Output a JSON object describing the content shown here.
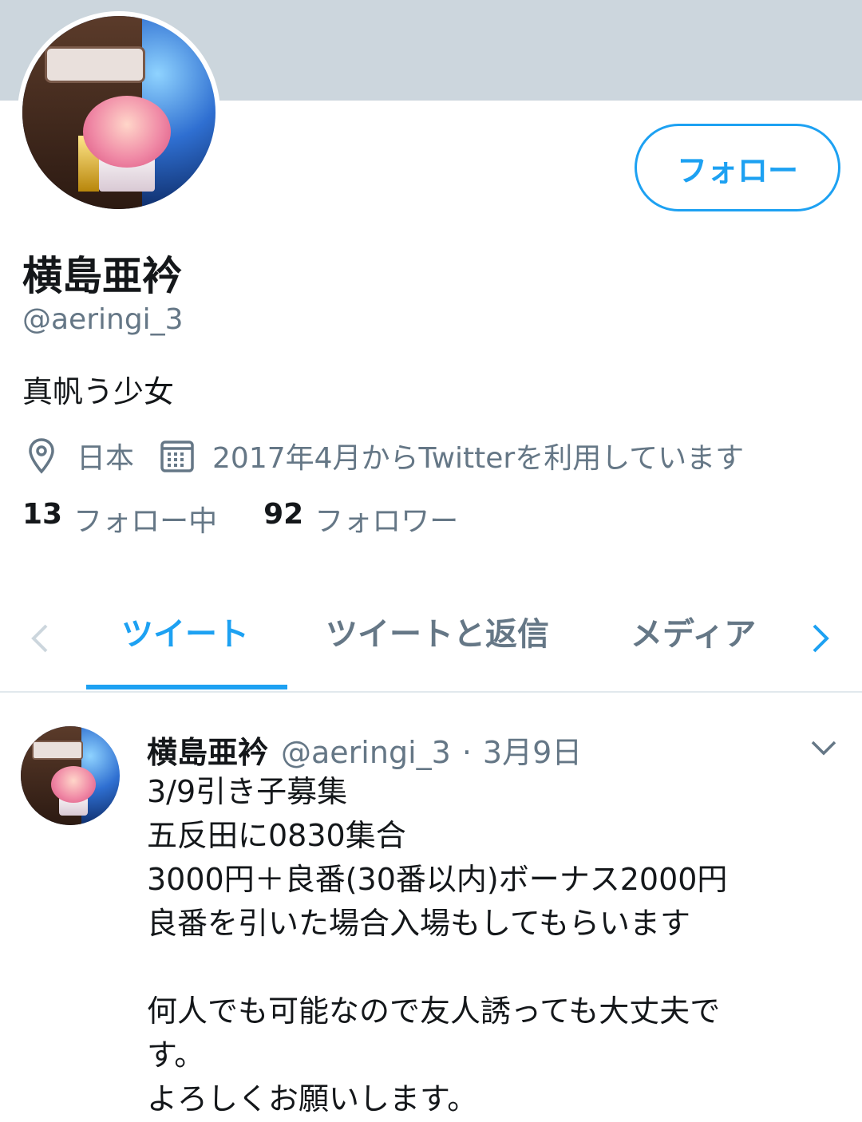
{
  "profile": {
    "display_name": "横島亜衿",
    "handle": "@aeringi_3",
    "bio": "真帆う少女",
    "location": "日本",
    "joined": "2017年4月からTwitterを利用しています",
    "following_count": "13",
    "following_label": "フォロー中",
    "followers_count": "92",
    "followers_label": "フォロワー",
    "follow_button": "フォロー"
  },
  "tabs": {
    "prev_icon": "chevron-left-icon",
    "next_icon": "chevron-right-icon",
    "items": [
      {
        "label": "ツイート",
        "active": true
      },
      {
        "label": "ツイートと返信",
        "active": false
      },
      {
        "label": "メディア",
        "active": false
      }
    ]
  },
  "tweet": {
    "name": "横島亜衿",
    "handle": "@aeringi_3",
    "separator": "·",
    "date": "3月9日",
    "text": "3/9引き子募集\n五反田に0830集合\n3000円＋良番(30番以内)ボーナス2000円\n良番を引いた場合入場もしてもらいます\n\n何人でも可能なので友人誘っても大丈夫で\nす。\nよろしくお願いします。"
  },
  "colors": {
    "accent": "#1da1f2",
    "banner": "#ccd6dd",
    "secondary_text": "#657786",
    "primary_text": "#14171a"
  }
}
